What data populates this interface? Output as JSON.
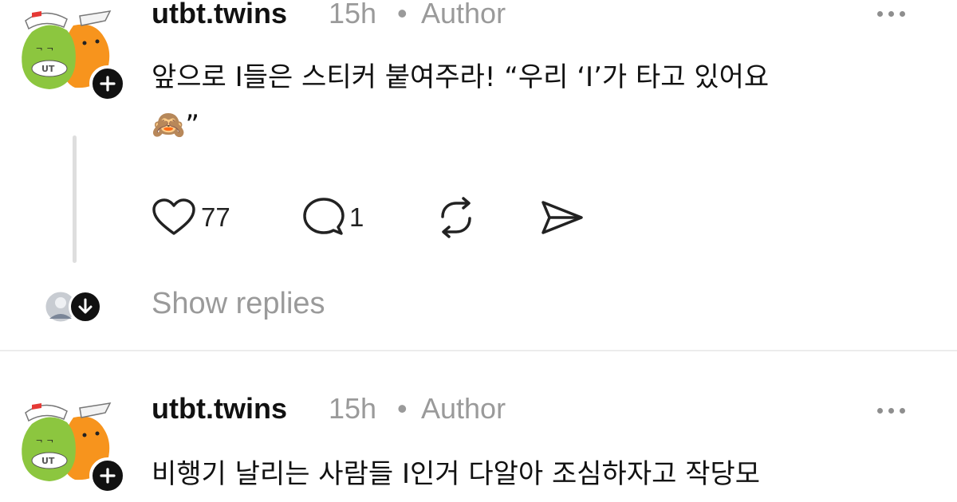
{
  "posts": [
    {
      "username": "utbt.twins",
      "time": "15h",
      "separator": "•",
      "role": "Author",
      "text_line1": "앞으로 I들은 스티커 붙여주라! “우리 ‘I’가 타고 있어요",
      "text_line2_after_emoji": "”",
      "emoji": "🙈",
      "likes": "77",
      "comments": "1",
      "show_replies": "Show replies",
      "avatar_label": "UT"
    },
    {
      "username": "utbt.twins",
      "time": "15h",
      "separator": "•",
      "role": "Author",
      "text_line1": "비행기 날리는 사람들 I인거 다알아 조심하자고 작당모",
      "avatar_label": "UT"
    }
  ],
  "icons": {
    "like": "heart-icon",
    "comment": "comment-icon",
    "repost": "repost-icon",
    "share": "send-icon",
    "more": "more-icon",
    "follow": "plus-icon",
    "expand": "arrow-down-icon"
  },
  "colors": {
    "avatar_green": "#8cc63f",
    "avatar_orange": "#f7941d",
    "muted_text": "#9a9a9a"
  }
}
